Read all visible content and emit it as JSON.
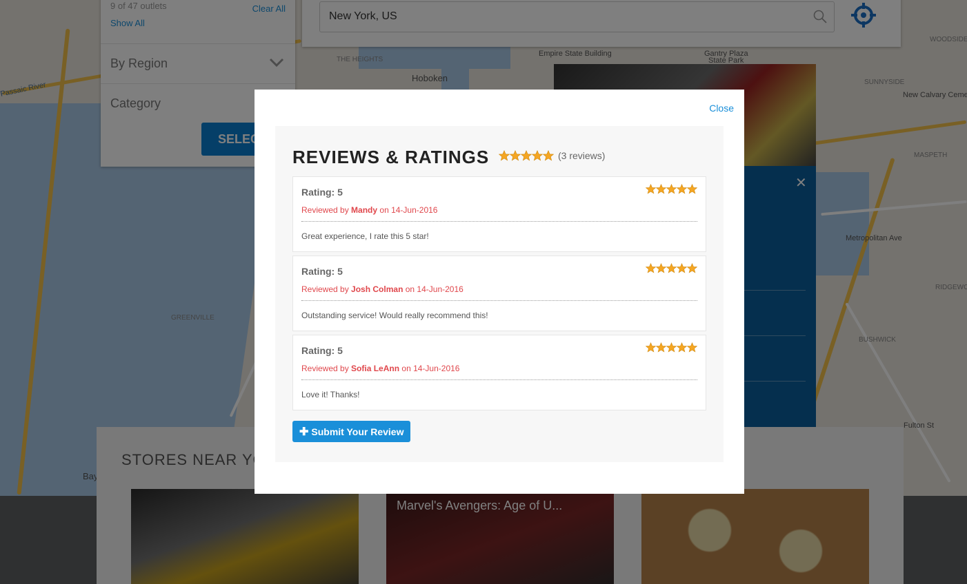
{
  "filter": {
    "outlet_count": "9 of 47 outlets",
    "clear_all": "Clear All",
    "show_all": "Show All",
    "region_label": "By Region",
    "category_label": "Category",
    "select_button": "SELEC"
  },
  "search": {
    "value": "New York, US"
  },
  "map_labels": {
    "hoboken": "Hoboken",
    "empire": "Empire State Building",
    "gantry": "Gantry Plaza",
    "state_park": "State Park",
    "heights": "THE HEIGHTS",
    "passaic": "Passaic River",
    "greenville": "GREENVILLE",
    "metropolitan": "Metropolitan Ave",
    "sunnyside": "SUNNYSIDE",
    "calvary": "New Calvary Ceme",
    "maspeth": "MASPETH",
    "ridgewood": "RIDGEWOOD",
    "bushwick": "BUSHWICK",
    "woodside": "WOODSIDE",
    "bay": "Bay",
    "fulton": "Fulton St"
  },
  "stores": {
    "heading": "STORES NEAR YO",
    "video_title": "Marvel's Avengers: Age of U..."
  },
  "modal": {
    "close_label": "Close",
    "title": "REVIEWS & RATINGS",
    "overall_stars": 5,
    "review_count": "(3 reviews)",
    "submit_label": "Submit Your Review",
    "reviews": [
      {
        "rating_label": "Rating: 5",
        "reviewed_by": "Reviewed by ",
        "reviewer": "Mandy",
        "on_date": " on 14-Jun-2016",
        "text": "Great experience, I rate this 5 star!",
        "stars": 5
      },
      {
        "rating_label": "Rating: 5",
        "reviewed_by": "Reviewed by ",
        "reviewer": "Josh Colman",
        "on_date": " on 14-Jun-2016",
        "text": "Outstanding service! Would really recommend this!",
        "stars": 5
      },
      {
        "rating_label": "Rating: 5",
        "reviewed_by": "Reviewed by ",
        "reviewer": "Sofia LeAnn",
        "on_date": " on 14-Jun-2016",
        "text": "Love it! Thanks!",
        "stars": 5
      }
    ]
  },
  "colors": {
    "accent": "#1a8fd9",
    "reviewer_red": "#e0474c",
    "star_gold": "#f5a623"
  }
}
